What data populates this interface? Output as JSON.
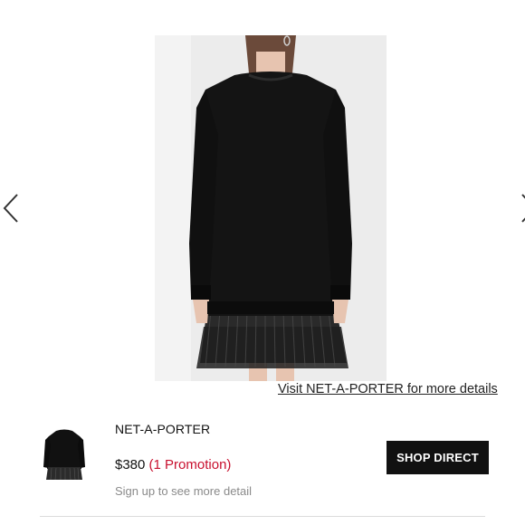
{
  "carousel": {
    "prev_icon": "chevron-left-icon",
    "next_icon": "chevron-right-icon",
    "image_alt_icon": "product-photo"
  },
  "visit_link": "Visit NET-A-PORTER for more details",
  "listing": {
    "retailer": "NET-A-PORTER",
    "price": "$380",
    "promotion": "(1 Promotion)",
    "signup_text": "Sign up to see more detail",
    "shop_button": "SHOP DIRECT"
  },
  "colors": {
    "promotion": "#c8102e",
    "button_bg": "#111111",
    "button_text": "#ffffff",
    "muted_text": "#8a8a8a"
  }
}
